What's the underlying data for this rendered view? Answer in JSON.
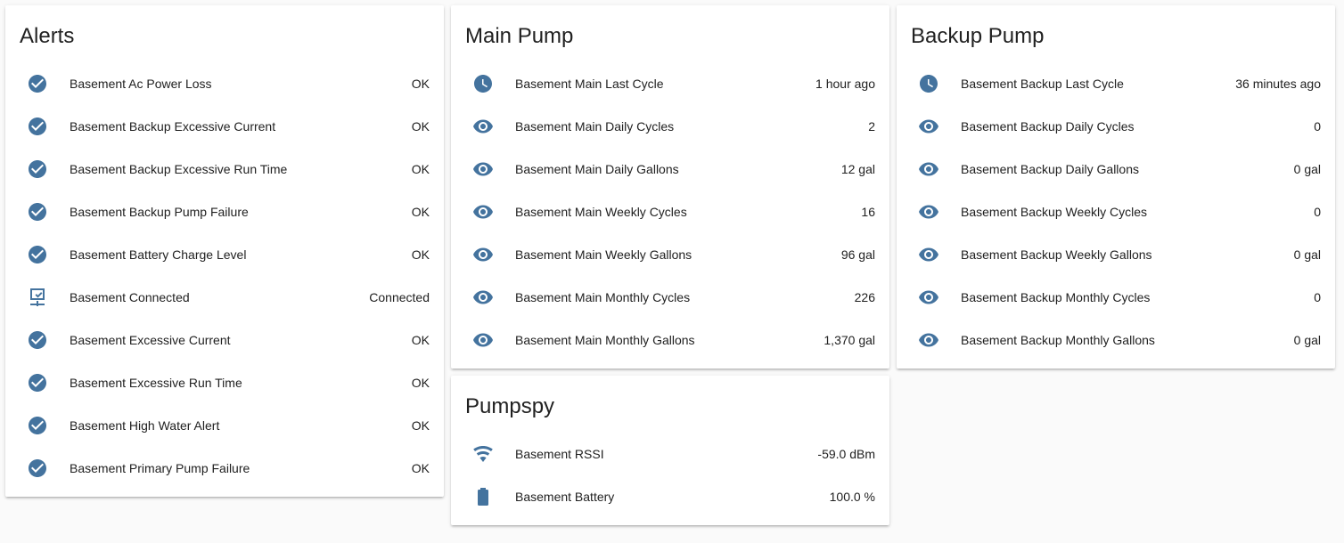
{
  "colors": {
    "icon": "#44739e",
    "background": "#fafafa",
    "card": "#ffffff"
  },
  "alerts": {
    "title": "Alerts",
    "rows": [
      {
        "icon": "check-circle-icon",
        "name": "Basement Ac Power Loss",
        "state": "OK"
      },
      {
        "icon": "check-circle-icon",
        "name": "Basement Backup Excessive Current",
        "state": "OK"
      },
      {
        "icon": "check-circle-icon",
        "name": "Basement Backup Excessive Run Time",
        "state": "OK"
      },
      {
        "icon": "check-circle-icon",
        "name": "Basement Backup Pump Failure",
        "state": "OK"
      },
      {
        "icon": "check-circle-icon",
        "name": "Basement Battery Charge Level",
        "state": "OK"
      },
      {
        "icon": "lan-connect-icon",
        "name": "Basement Connected",
        "state": "Connected"
      },
      {
        "icon": "check-circle-icon",
        "name": "Basement Excessive Current",
        "state": "OK"
      },
      {
        "icon": "check-circle-icon",
        "name": "Basement Excessive Run Time",
        "state": "OK"
      },
      {
        "icon": "check-circle-icon",
        "name": "Basement High Water Alert",
        "state": "OK"
      },
      {
        "icon": "check-circle-icon",
        "name": "Basement Primary Pump Failure",
        "state": "OK"
      }
    ]
  },
  "main_pump": {
    "title": "Main Pump",
    "rows": [
      {
        "icon": "clock-icon",
        "name": "Basement Main Last Cycle",
        "state": "1 hour ago"
      },
      {
        "icon": "eye-icon",
        "name": "Basement Main Daily Cycles",
        "state": "2"
      },
      {
        "icon": "eye-icon",
        "name": "Basement Main Daily Gallons",
        "state": "12 gal"
      },
      {
        "icon": "eye-icon",
        "name": "Basement Main Weekly Cycles",
        "state": "16"
      },
      {
        "icon": "eye-icon",
        "name": "Basement Main Weekly Gallons",
        "state": "96 gal"
      },
      {
        "icon": "eye-icon",
        "name": "Basement Main Monthly Cycles",
        "state": "226"
      },
      {
        "icon": "eye-icon",
        "name": "Basement Main Monthly Gallons",
        "state": "1,370 gal"
      }
    ]
  },
  "pumpspy": {
    "title": "Pumpspy",
    "rows": [
      {
        "icon": "wifi-icon",
        "name": "Basement RSSI",
        "state": "-59.0 dBm"
      },
      {
        "icon": "battery-icon",
        "name": "Basement Battery",
        "state": "100.0 %"
      }
    ]
  },
  "backup_pump": {
    "title": "Backup Pump",
    "rows": [
      {
        "icon": "clock-icon",
        "name": "Basement Backup Last Cycle",
        "state": "36 minutes ago"
      },
      {
        "icon": "eye-icon",
        "name": "Basement Backup Daily Cycles",
        "state": "0"
      },
      {
        "icon": "eye-icon",
        "name": "Basement Backup Daily Gallons",
        "state": "0 gal"
      },
      {
        "icon": "eye-icon",
        "name": "Basement Backup Weekly Cycles",
        "state": "0"
      },
      {
        "icon": "eye-icon",
        "name": "Basement Backup Weekly Gallons",
        "state": "0 gal"
      },
      {
        "icon": "eye-icon",
        "name": "Basement Backup Monthly Cycles",
        "state": "0"
      },
      {
        "icon": "eye-icon",
        "name": "Basement Backup Monthly Gallons",
        "state": "0 gal"
      }
    ]
  }
}
